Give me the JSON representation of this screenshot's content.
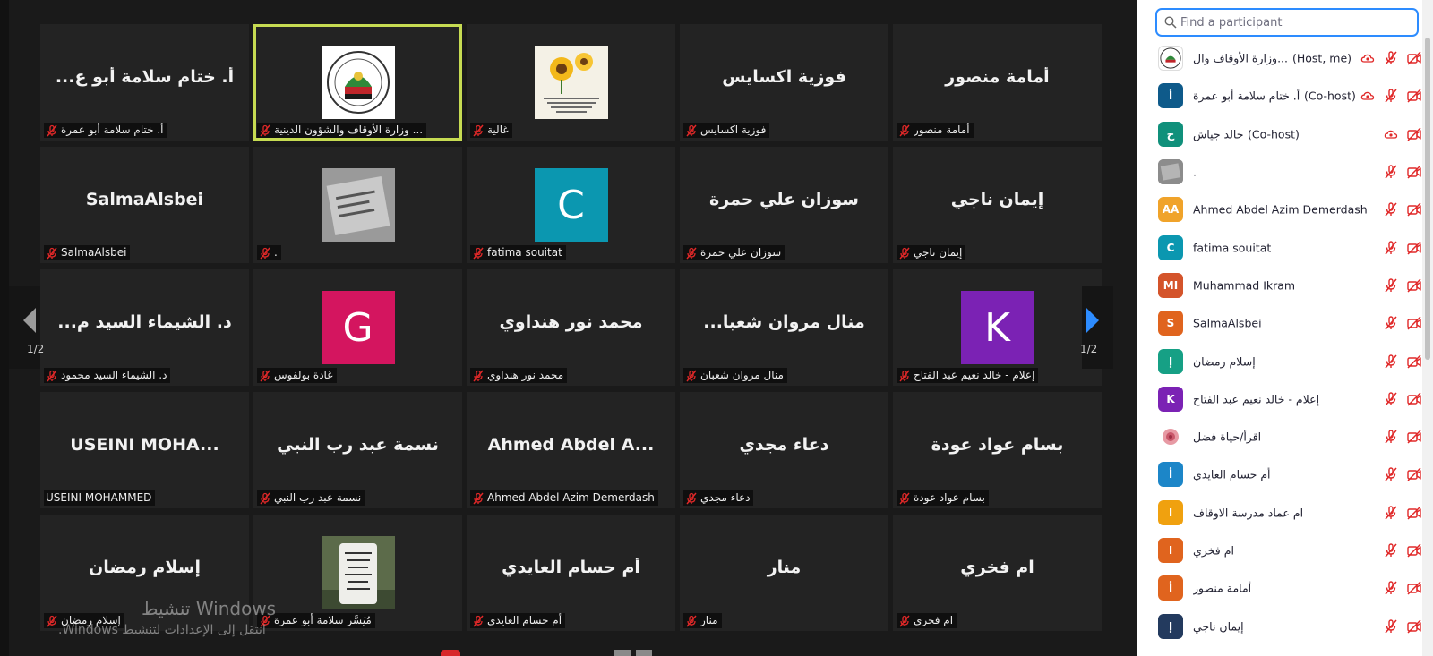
{
  "gallery": {
    "page_left": "1/2",
    "page_right": "1/2",
    "tiles": [
      {
        "big": "أ. ختام سلامة أبو ع...",
        "label": "أ. ختام سلامة أبو عمرة",
        "muted": true
      },
      {
        "big": "",
        "label": "وزارة الأوقاف والشؤون الدينية ...",
        "muted": true,
        "pic": "ministry-logo",
        "active": true
      },
      {
        "big": "",
        "label": "غالية",
        "muted": true,
        "pic": "sunflower"
      },
      {
        "big": "فوزية اكسايس",
        "label": "فوزية اكسايس",
        "muted": true
      },
      {
        "big": "أمامة منصور",
        "label": "أمامة منصور",
        "muted": true
      },
      {
        "big": "SalmaAlsbei",
        "label": "SalmaAlsbei",
        "muted": true,
        "ltr": true
      },
      {
        "big": "",
        "label": ".",
        "muted": true,
        "pic": "notebook-photo"
      },
      {
        "big": "",
        "label": "fatima souitat",
        "muted": true,
        "avatar": "C",
        "avatar_color": "#0b97b0"
      },
      {
        "big": "سوزان علي حمرة",
        "label": "سوزان علي حمرة",
        "muted": true
      },
      {
        "big": "إيمان ناجي",
        "label": "إيمان ناجي",
        "muted": true
      },
      {
        "big": "د. الشيماء السيد م...",
        "label": "د. الشيماء السيد محمود",
        "muted": true
      },
      {
        "big": "",
        "label": "غادة بولفوس",
        "muted": true,
        "avatar": "G",
        "avatar_color": "#d4155f"
      },
      {
        "big": "محمد نور هنداوي",
        "label": "محمد نور هنداوي",
        "muted": true
      },
      {
        "big": "منال مروان شعبا...",
        "label": "منال مروان شعبان",
        "muted": true
      },
      {
        "big": "",
        "label": "إعلام - خالد نعيم عبد الفتاح",
        "muted": true,
        "avatar": "K",
        "avatar_color": "#7b22b4"
      },
      {
        "big": "USEINI MOHA...",
        "label": "USEINI MOHAMMED",
        "muted": false,
        "ltr": true
      },
      {
        "big": "نسمة عبد رب النبي",
        "label": "نسمة عبد رب النبي",
        "muted": true
      },
      {
        "big": "Ahmed Abdel A...",
        "label": "Ahmed Abdel Azim Demerdash",
        "muted": true,
        "ltr": true
      },
      {
        "big": "دعاء مجدي",
        "label": "دعاء مجدي",
        "muted": true
      },
      {
        "big": "بسام عواد عودة",
        "label": "بسام عواد عودة",
        "muted": true
      },
      {
        "big": "إسلام رمضان",
        "label": "إسلام رمضان",
        "muted": true
      },
      {
        "big": "",
        "label": "مُيَسَّر سلامة أبو عمرة",
        "muted": true,
        "pic": "gravestone"
      },
      {
        "big": "أم حسام العايدي",
        "label": "أم حسام العايدي",
        "muted": true
      },
      {
        "big": "منار",
        "label": "منار",
        "muted": true
      },
      {
        "big": "ام فخري",
        "label": "ام فخري",
        "muted": true
      }
    ]
  },
  "watermark": {
    "line1": "تنشيط Windows",
    "line2": "انتقل إلى الإعدادات لتنشيط Windows."
  },
  "panel": {
    "search_placeholder": "Find a participant",
    "participants": [
      {
        "name": "وزارة الأوقاف وال...",
        "tag": "(Host, me)",
        "avatar_type": "pic",
        "cloud": true
      },
      {
        "name": "أ. ختام سلامة أبو عمرة",
        "tag": "(Co-host)",
        "avatar": "أ",
        "color": "#0e5a8a",
        "cloud": true
      },
      {
        "name": "خالد جياش",
        "tag": "(Co-host)",
        "avatar": "خ",
        "color": "#10907b",
        "cloud": true,
        "no_mic": true
      },
      {
        "name": ".",
        "tag": "",
        "avatar_type": "photo"
      },
      {
        "name": "Ahmed Abdel Azim Demerdash",
        "tag": "",
        "avatar": "AA",
        "color": "#f0a32a"
      },
      {
        "name": "fatima souitat",
        "tag": "",
        "avatar": "C",
        "color": "#0b97b0"
      },
      {
        "name": "Muhammad Ikram",
        "tag": "",
        "avatar": "MI",
        "color": "#d4542b"
      },
      {
        "name": "SalmaAlsbei",
        "tag": "",
        "avatar": "S",
        "color": "#e0641e"
      },
      {
        "name": "إسلام رمضان",
        "tag": "",
        "avatar": "إ",
        "color": "#16a085"
      },
      {
        "name": "إعلام - خالد نعيم عبد الفتاح",
        "tag": "",
        "avatar": "K",
        "color": "#7b22b4"
      },
      {
        "name": "اقرأ/حياة فضل",
        "tag": "",
        "avatar_type": "flower"
      },
      {
        "name": "أم حسام العايدي",
        "tag": "",
        "avatar": "أ",
        "color": "#1c86c8"
      },
      {
        "name": "ام عماد مدرسة الاوقاف",
        "tag": "",
        "avatar": "ا",
        "color": "#f0a10f"
      },
      {
        "name": "ام فخري",
        "tag": "",
        "avatar": "ا",
        "color": "#e0641e"
      },
      {
        "name": "أمامة منصور",
        "tag": "",
        "avatar": "أ",
        "color": "#e0641e"
      },
      {
        "name": "إيمان ناجي",
        "tag": "",
        "avatar": "إ",
        "color": "#233a5e"
      }
    ]
  }
}
